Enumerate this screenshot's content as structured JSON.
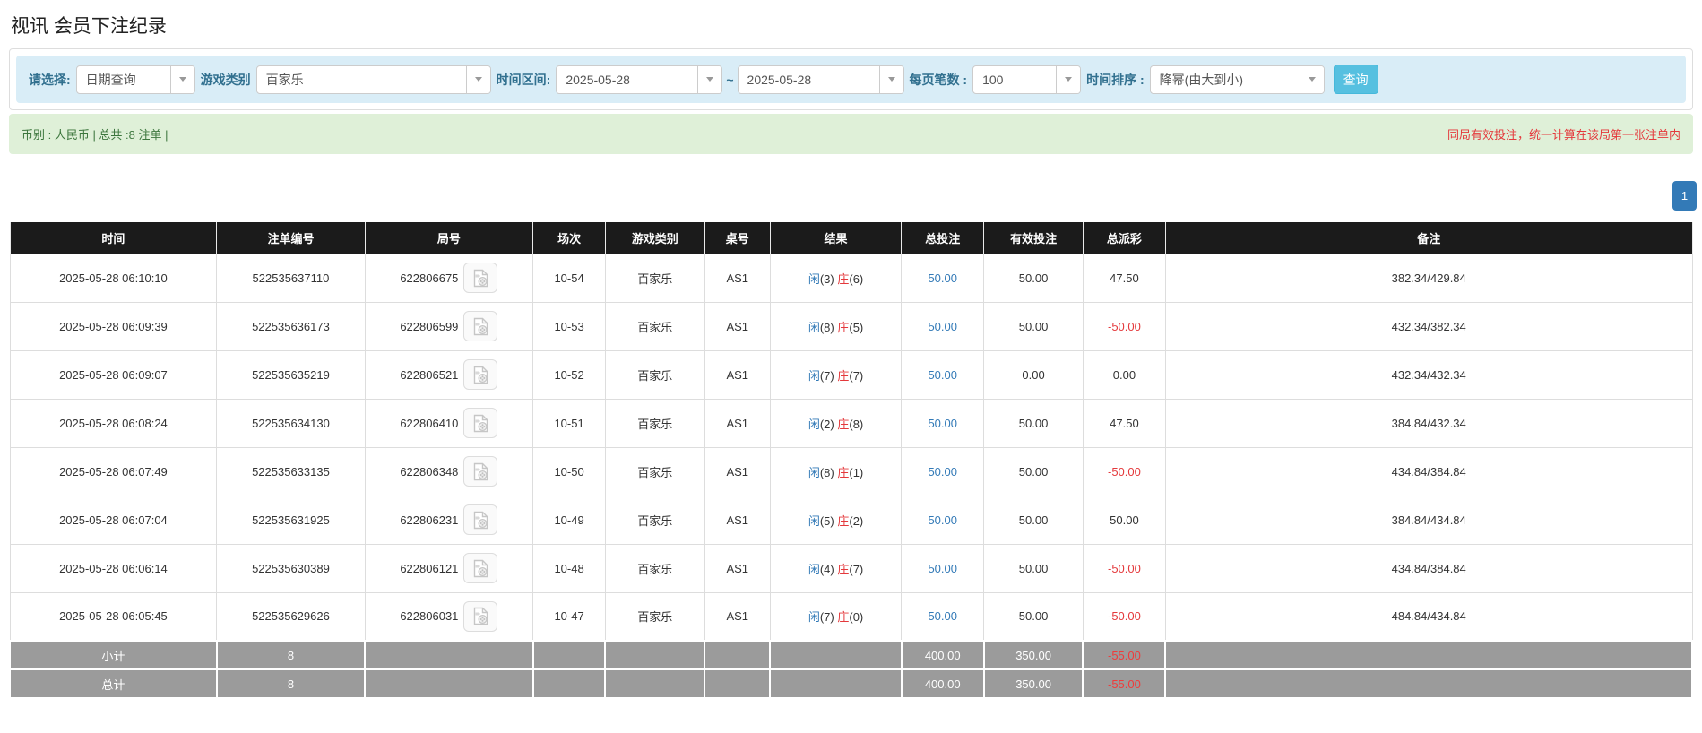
{
  "title": "视讯 会员下注纪录",
  "filter": {
    "select_label": "请选择:",
    "select_value": "日期查询",
    "game_type_label": "游戏类别",
    "game_type_value": "百家乐",
    "date_range_label": "时间区间:",
    "date_from": "2025-05-28",
    "date_separator": "~",
    "date_to": "2025-05-28",
    "page_size_label": "每页笔数 :",
    "page_size_value": "100",
    "sort_label": "时间排序 :",
    "sort_value": "降幂(由大到小)",
    "search_button": "查询"
  },
  "summary": {
    "info": "币别 : 人民币 | 总共 :8 注单 |",
    "notice": "同局有效投注，统一计算在该局第一张注单内"
  },
  "pagination": {
    "current_page": "1"
  },
  "table": {
    "headers": [
      "时间",
      "注单编号",
      "局号",
      "场次",
      "游戏类别",
      "桌号",
      "结果",
      "总投注",
      "有效投注",
      "总派彩",
      "备注"
    ],
    "rows": [
      {
        "time": "2025-05-28 06:10:10",
        "bet_no": "522535637110",
        "round_no": "622806675",
        "session": "10-54",
        "game": "百家乐",
        "table_no": "AS1",
        "result_player": "闲",
        "result_player_num": "(3)",
        "result_banker": "庄",
        "result_banker_num": "(6)",
        "total_bet": "50.00",
        "valid_bet": "50.00",
        "payout": "47.50",
        "remark": "382.34/429.84"
      },
      {
        "time": "2025-05-28 06:09:39",
        "bet_no": "522535636173",
        "round_no": "622806599",
        "session": "10-53",
        "game": "百家乐",
        "table_no": "AS1",
        "result_player": "闲",
        "result_player_num": "(8)",
        "result_banker": "庄",
        "result_banker_num": "(5)",
        "total_bet": "50.00",
        "valid_bet": "50.00",
        "payout": "-50.00",
        "remark": "432.34/382.34"
      },
      {
        "time": "2025-05-28 06:09:07",
        "bet_no": "522535635219",
        "round_no": "622806521",
        "session": "10-52",
        "game": "百家乐",
        "table_no": "AS1",
        "result_player": "闲",
        "result_player_num": "(7)",
        "result_banker": "庄",
        "result_banker_num": "(7)",
        "total_bet": "50.00",
        "valid_bet": "0.00",
        "payout": "0.00",
        "remark": "432.34/432.34"
      },
      {
        "time": "2025-05-28 06:08:24",
        "bet_no": "522535634130",
        "round_no": "622806410",
        "session": "10-51",
        "game": "百家乐",
        "table_no": "AS1",
        "result_player": "闲",
        "result_player_num": "(2)",
        "result_banker": "庄",
        "result_banker_num": "(8)",
        "total_bet": "50.00",
        "valid_bet": "50.00",
        "payout": "47.50",
        "remark": "384.84/432.34"
      },
      {
        "time": "2025-05-28 06:07:49",
        "bet_no": "522535633135",
        "round_no": "622806348",
        "session": "10-50",
        "game": "百家乐",
        "table_no": "AS1",
        "result_player": "闲",
        "result_player_num": "(8)",
        "result_banker": "庄",
        "result_banker_num": "(1)",
        "total_bet": "50.00",
        "valid_bet": "50.00",
        "payout": "-50.00",
        "remark": "434.84/384.84"
      },
      {
        "time": "2025-05-28 06:07:04",
        "bet_no": "522535631925",
        "round_no": "622806231",
        "session": "10-49",
        "game": "百家乐",
        "table_no": "AS1",
        "result_player": "闲",
        "result_player_num": "(5)",
        "result_banker": "庄",
        "result_banker_num": "(2)",
        "total_bet": "50.00",
        "valid_bet": "50.00",
        "payout": "50.00",
        "remark": "384.84/434.84"
      },
      {
        "time": "2025-05-28 06:06:14",
        "bet_no": "522535630389",
        "round_no": "622806121",
        "session": "10-48",
        "game": "百家乐",
        "table_no": "AS1",
        "result_player": "闲",
        "result_player_num": "(4)",
        "result_banker": "庄",
        "result_banker_num": "(7)",
        "total_bet": "50.00",
        "valid_bet": "50.00",
        "payout": "-50.00",
        "remark": "434.84/384.84"
      },
      {
        "time": "2025-05-28 06:05:45",
        "bet_no": "522535629626",
        "round_no": "622806031",
        "session": "10-47",
        "game": "百家乐",
        "table_no": "AS1",
        "result_player": "闲",
        "result_player_num": "(7)",
        "result_banker": "庄",
        "result_banker_num": "(0)",
        "total_bet": "50.00",
        "valid_bet": "50.00",
        "payout": "-50.00",
        "remark": "484.84/434.84"
      }
    ],
    "footer_rows": [
      {
        "label": "小计",
        "count": "8",
        "total_bet": "400.00",
        "valid_bet": "350.00",
        "payout": "-55.00"
      },
      {
        "label": "总计",
        "count": "8",
        "total_bet": "400.00",
        "valid_bet": "350.00",
        "payout": "-55.00"
      }
    ]
  },
  "icons": {
    "dropdown_caret": "caret-down",
    "round_video_icon": "video-record-file"
  },
  "colors": {
    "header_bg": "#1b1b1b",
    "accent_blue": "#337ab7",
    "player_blue": "#337ab7",
    "banker_red": "#e4393c",
    "negative_red": "#e4393c",
    "notice_red": "#e4393c",
    "panel_blue": "#d9edf7",
    "label_blue": "#31708f",
    "alert_green_bg": "#dff0d8",
    "alert_green_text": "#3c763d",
    "footer_gray": "#9b9b9b",
    "search_button_cyan": "#56c0e0",
    "pager_blue": "#337ab7"
  }
}
